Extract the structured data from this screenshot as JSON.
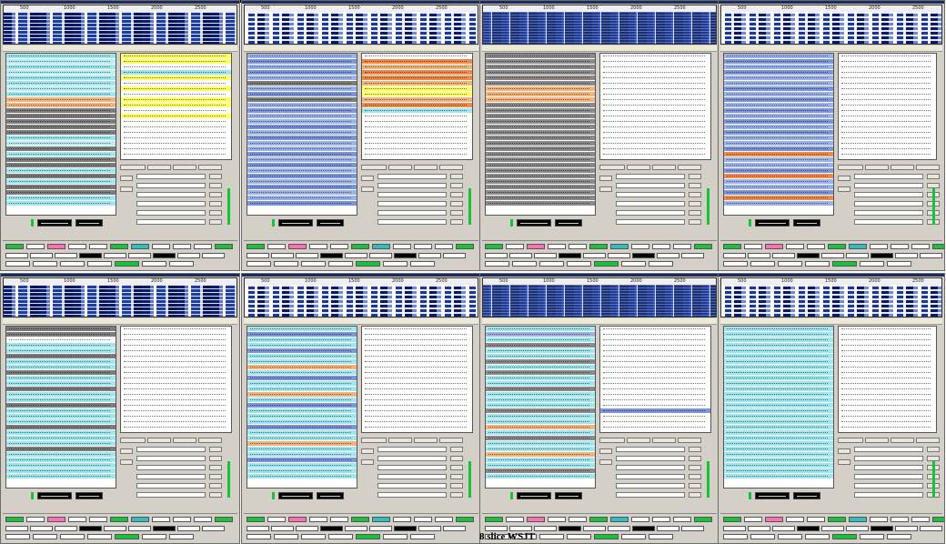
{
  "caption": "8 slice WSJT",
  "slices": [
    {
      "id": "slice-1",
      "waterfall": "A",
      "scale": [
        "500",
        "1000",
        "1500",
        "2000",
        "2500"
      ],
      "left_rows": [
        "#9fe6ef",
        "#b8eef3",
        "#9fe6ef",
        "#b8eef3",
        "#9fe6ef",
        "#9fe6ef",
        "#b8eef3",
        "#9fe6ef",
        "#f2b37d",
        "#f2b37d",
        "#7c7c7c",
        "#7c7c7c",
        "#7c7c7c",
        "#7c7c7c",
        "#7c7c7c",
        "#9fe6ef",
        "#b8eef3",
        "#7c7c7c",
        "#9fe6ef",
        "#7c7c7c",
        "#7c7c7c",
        "#9fe6ef",
        "#7c7c7c",
        "#9fe6ef",
        "#7c7c7c",
        "#7c7c7c",
        "#9fe6ef",
        "#9fe6ef"
      ],
      "right_rows": [
        "#ffff66",
        "#ffff66",
        "#ffffff",
        "#9fe6ef",
        "#ffff66",
        "#ffffff",
        "#ffff66",
        "#ffffff",
        "#ffff66",
        "#ffff66",
        "#ffffff",
        "#ffff66",
        "#ffffff",
        "#ffffff",
        "#ffffff",
        "#ffffff",
        "#ffffff",
        "#ffffff",
        "#ffffff"
      ]
    },
    {
      "id": "slice-2",
      "waterfall": "B",
      "scale": [
        "500",
        "1000",
        "1500",
        "2000",
        "2500"
      ],
      "left_rows": [
        "#9bb3e6",
        "#7c95d8",
        "#9bb3e6",
        "#7c95d8",
        "#9bb3e6",
        "#7c7c7c",
        "#9bb3e6",
        "#7c95d8",
        "#7c7c7c",
        "#9bb3e6",
        "#7c95d8",
        "#9bb3e6",
        "#9bb3e6",
        "#7c95d8",
        "#9bb3e6",
        "#7c95d8",
        "#9bb3e6",
        "#9bb3e6",
        "#7c95d8",
        "#9bb3e6",
        "#7c95d8",
        "#9bb3e6",
        "#7c95d8",
        "#9bb3e6",
        "#7c95d8",
        "#9bb3e6",
        "#9bb3e6",
        "#7c95d8"
      ],
      "right_rows": [
        "#ffffff",
        "#f08a4b",
        "#f2b37d",
        "#f08a4b",
        "#f08a4b",
        "#f2b37d",
        "#ffff66",
        "#ffff66",
        "#f2b37d",
        "#f08a4b",
        "#9fe6ef",
        "#ffffff",
        "#ffffff",
        "#ffffff",
        "#ffffff",
        "#ffffff",
        "#ffffff",
        "#ffffff",
        "#ffffff"
      ]
    },
    {
      "id": "slice-3",
      "waterfall": "C",
      "scale": [
        "500",
        "1000",
        "1500",
        "2000",
        "2500"
      ],
      "left_rows": [
        "#8a8a8a",
        "#8a8a8a",
        "#8a8a8a",
        "#8a8a8a",
        "#8a8a8a",
        "#8a8a8a",
        "#f2b37d",
        "#f2b37d",
        "#f2b37d",
        "#8a8a8a",
        "#8a8a8a",
        "#8a8a8a",
        "#8a8a8a",
        "#8a8a8a",
        "#8a8a8a",
        "#8a8a8a",
        "#8a8a8a",
        "#8a8a8a",
        "#8a8a8a",
        "#8a8a8a",
        "#8a8a8a",
        "#8a8a8a",
        "#8a8a8a",
        "#8a8a8a",
        "#8a8a8a",
        "#8a8a8a",
        "#8a8a8a",
        "#8a8a8a"
      ],
      "right_rows": [
        "#ffffff",
        "#ffffff",
        "#ffffff",
        "#ffffff",
        "#ffffff",
        "#ffffff",
        "#ffffff",
        "#ffffff",
        "#ffffff",
        "#ffffff",
        "#ffffff",
        "#ffffff",
        "#ffffff",
        "#ffffff",
        "#ffffff",
        "#ffffff",
        "#ffffff",
        "#ffffff",
        "#ffffff"
      ]
    },
    {
      "id": "slice-4",
      "waterfall": "B",
      "scale": [
        "500",
        "1000",
        "1500",
        "2000",
        "2500"
      ],
      "left_rows": [
        "#9bb3e6",
        "#7c95d8",
        "#9bb3e6",
        "#7c95d8",
        "#9bb3e6",
        "#9bb3e6",
        "#7c95d8",
        "#9bb3e6",
        "#7c95d8",
        "#9bb3e6",
        "#7c95d8",
        "#9bb3e6",
        "#7c95d8",
        "#9bb3e6",
        "#7c95d8",
        "#9bb3e6",
        "#9bb3e6",
        "#7c95d8",
        "#f08a4b",
        "#9bb3e6",
        "#9bb3e6",
        "#7c95d8",
        "#f08a4b",
        "#9bb3e6",
        "#9bb3e6",
        "#7c95d8",
        "#f08a4b",
        "#9bb3e6"
      ],
      "right_rows": [
        "#ffffff",
        "#ffffff",
        "#ffffff",
        "#ffffff",
        "#ffffff",
        "#ffffff",
        "#ffffff",
        "#ffffff",
        "#ffffff",
        "#ffffff",
        "#ffffff",
        "#ffffff",
        "#ffffff",
        "#ffffff",
        "#ffffff",
        "#ffffff",
        "#ffffff",
        "#ffffff",
        "#ffffff"
      ]
    },
    {
      "id": "slice-5",
      "waterfall": "A",
      "scale": [
        "500",
        "1000",
        "1500",
        "2000",
        "2500"
      ],
      "left_rows": [
        "#7c7c7c",
        "#7c7c7c",
        "#ffffff",
        "#9fe6ef",
        "#9fe6ef",
        "#7c7c7c",
        "#9fe6ef",
        "#9fe6ef",
        "#7c7c7c",
        "#9fe6ef",
        "#9fe6ef",
        "#7c7c7c",
        "#9fe6ef",
        "#9fe6ef",
        "#7c7c7c",
        "#9fe6ef",
        "#9fe6ef",
        "#9fe6ef",
        "#7c7c7c",
        "#9fe6ef",
        "#9fe6ef",
        "#9fe6ef",
        "#7c7c7c",
        "#9fe6ef",
        "#9fe6ef",
        "#9fe6ef",
        "#9fe6ef",
        "#9fe6ef"
      ],
      "right_rows": [
        "#ffffff",
        "#ffffff",
        "#ffffff",
        "#ffffff",
        "#ffffff",
        "#ffffff",
        "#ffffff",
        "#ffffff",
        "#ffffff",
        "#ffffff",
        "#ffffff",
        "#ffffff",
        "#ffffff",
        "#ffffff",
        "#ffffff",
        "#ffffff",
        "#ffffff",
        "#ffffff",
        "#ffffff"
      ]
    },
    {
      "id": "slice-6",
      "waterfall": "B",
      "scale": [
        "500",
        "1000",
        "1500",
        "2000",
        "2500"
      ],
      "left_rows": [
        "#9fe6ef",
        "#7c95d8",
        "#9fe6ef",
        "#9fe6ef",
        "#7c95d8",
        "#9fe6ef",
        "#9fe6ef",
        "#f2b37d",
        "#9fe6ef",
        "#7c95d8",
        "#9fe6ef",
        "#9fe6ef",
        "#f2b37d",
        "#9fe6ef",
        "#7c95d8",
        "#9fe6ef",
        "#9fe6ef",
        "#9fe6ef",
        "#7c95d8",
        "#9fe6ef",
        "#9fe6ef",
        "#f2b37d",
        "#9fe6ef",
        "#9fe6ef",
        "#7c95d8",
        "#9fe6ef",
        "#9fe6ef",
        "#9fe6ef"
      ],
      "right_rows": [
        "#ffffff",
        "#ffffff",
        "#ffffff",
        "#ffffff",
        "#ffffff",
        "#ffffff",
        "#ffffff",
        "#ffffff",
        "#ffffff",
        "#ffffff",
        "#ffffff",
        "#ffffff",
        "#ffffff",
        "#ffffff",
        "#ffffff",
        "#ffffff",
        "#ffffff",
        "#ffffff",
        "#ffffff"
      ]
    },
    {
      "id": "slice-7",
      "waterfall": "C",
      "scale": [
        "500",
        "1000",
        "1500",
        "2000",
        "2500"
      ],
      "left_rows": [
        "#9fe6ef",
        "#9bb3e6",
        "#9fe6ef",
        "#8a8a8a",
        "#9fe6ef",
        "#9fe6ef",
        "#8a8a8a",
        "#9fe6ef",
        "#8a8a8a",
        "#9fe6ef",
        "#9fe6ef",
        "#8a8a8a",
        "#9fe6ef",
        "#9fe6ef",
        "#9fe6ef",
        "#8a8a8a",
        "#9fe6ef",
        "#9fe6ef",
        "#f2b37d",
        "#9fe6ef",
        "#8a8a8a",
        "#9fe6ef",
        "#9fe6ef",
        "#f2b37d",
        "#9fe6ef",
        "#9fe6ef",
        "#8a8a8a",
        "#9fe6ef"
      ],
      "right_rows": [
        "#ffffff",
        "#ffffff",
        "#ffffff",
        "#ffffff",
        "#ffffff",
        "#ffffff",
        "#ffffff",
        "#ffffff",
        "#ffffff",
        "#ffffff",
        "#ffffff",
        "#ffffff",
        "#ffffff",
        "#ffffff",
        "#ffffff",
        "#7c95d8",
        "#ffffff",
        "#ffffff",
        "#ffffff"
      ]
    },
    {
      "id": "slice-8",
      "waterfall": "B",
      "scale": [
        "500",
        "1000",
        "1500",
        "2000",
        "2500"
      ],
      "left_rows": [
        "#9fe6ef",
        "#9fe6ef",
        "#9fe6ef",
        "#9fe6ef",
        "#9fe6ef",
        "#9fe6ef",
        "#9fe6ef",
        "#9fe6ef",
        "#9fe6ef",
        "#9fe6ef",
        "#9fe6ef",
        "#9fe6ef",
        "#9fe6ef",
        "#9fe6ef",
        "#9fe6ef",
        "#9fe6ef",
        "#9fe6ef",
        "#9fe6ef",
        "#9fe6ef",
        "#9fe6ef",
        "#9fe6ef",
        "#9fe6ef",
        "#9fe6ef",
        "#9fe6ef",
        "#9fe6ef",
        "#9fe6ef",
        "#9fe6ef",
        "#9fe6ef"
      ],
      "right_rows": [
        "#ffffff",
        "#ffffff",
        "#ffffff",
        "#ffffff",
        "#ffffff",
        "#ffffff",
        "#ffffff",
        "#ffffff",
        "#ffffff",
        "#ffffff",
        "#ffffff",
        "#ffffff",
        "#ffffff",
        "#ffffff",
        "#ffffff",
        "#ffffff",
        "#ffffff",
        "#ffffff",
        "#ffffff"
      ]
    }
  ],
  "status_colors": [
    "#18c23a",
    "#ff6fb5",
    "#2ec0c0",
    "#ffffff",
    "#000000",
    "#18c23a"
  ]
}
